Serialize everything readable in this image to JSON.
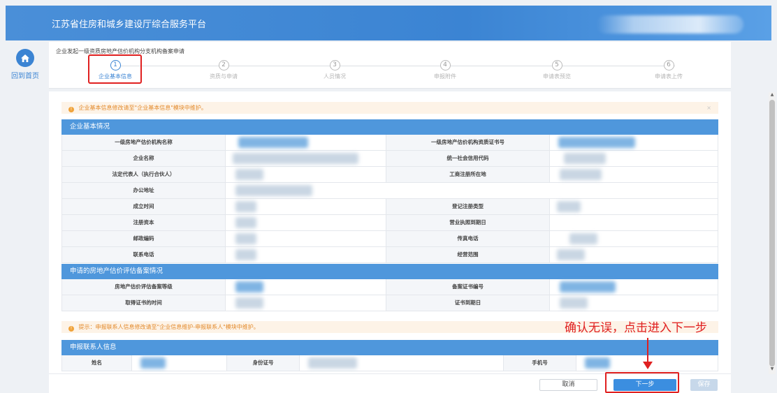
{
  "header": {
    "title": "江苏省住房和城乡建设厅综合服务平台"
  },
  "nav": {
    "home_label": "回到首页"
  },
  "breadcrumb": "企业发起一级资质房地产估价机构分支机构备案申请",
  "steps": [
    {
      "num": "1",
      "label": "企业基本信息",
      "active": true
    },
    {
      "num": "2",
      "label": "资质与申请",
      "active": false
    },
    {
      "num": "3",
      "label": "人员情况",
      "active": false
    },
    {
      "num": "4",
      "label": "申报附件",
      "active": false
    },
    {
      "num": "5",
      "label": "申请表预览",
      "active": false
    },
    {
      "num": "6",
      "label": "申请表上传",
      "active": false
    }
  ],
  "notice1": {
    "text": "企业基本信息修改请至\"企业基本信息\"模块中维护。",
    "close": "×"
  },
  "section1": {
    "title": "企业基本情况",
    "rows": [
      {
        "l1": "一级房地产估价机构名称",
        "l2": "一级房地产估价机构资质证书号"
      },
      {
        "l1": "企业名称",
        "l2": "统一社会信用代码"
      },
      {
        "l1": "法定代表人（执行合伙人）",
        "l2": "工商注册所在地"
      },
      {
        "l1": "办公地址",
        "l2": ""
      },
      {
        "l1": "成立时间",
        "l2": "登记注册类型"
      },
      {
        "l1": "注册资本",
        "l2": "营业执照到期日"
      },
      {
        "l1": "邮政编码",
        "l2": "传真电话"
      },
      {
        "l1": "联系电话",
        "l2": "经营范围"
      }
    ]
  },
  "section2": {
    "title": "申请的房地产估价评估备案情况",
    "rows": [
      {
        "l1": "房地产估价评估备案等级",
        "l2": "备案证书编号"
      },
      {
        "l1": "取得证书的时间",
        "l2": "证书到期日"
      }
    ]
  },
  "notice2": {
    "text": "提示：申报联系人信息修改请至\"企业信息维护-申报联系人\"模块中维护。"
  },
  "section3": {
    "title": "申报联系人信息",
    "labels": {
      "name": "姓名",
      "id": "身份证号",
      "phone": "手机号"
    }
  },
  "annotation": {
    "text": "确认无误，点击进入下一步"
  },
  "buttons": {
    "cancel": "取消",
    "next": "下一步",
    "save": "保存"
  },
  "colors": {
    "primary": "#3b84d3",
    "section": "#4f97dc",
    "highlight": "#e02020",
    "notice_bg": "#fdf3e7",
    "notice_text": "#e38a2b"
  }
}
